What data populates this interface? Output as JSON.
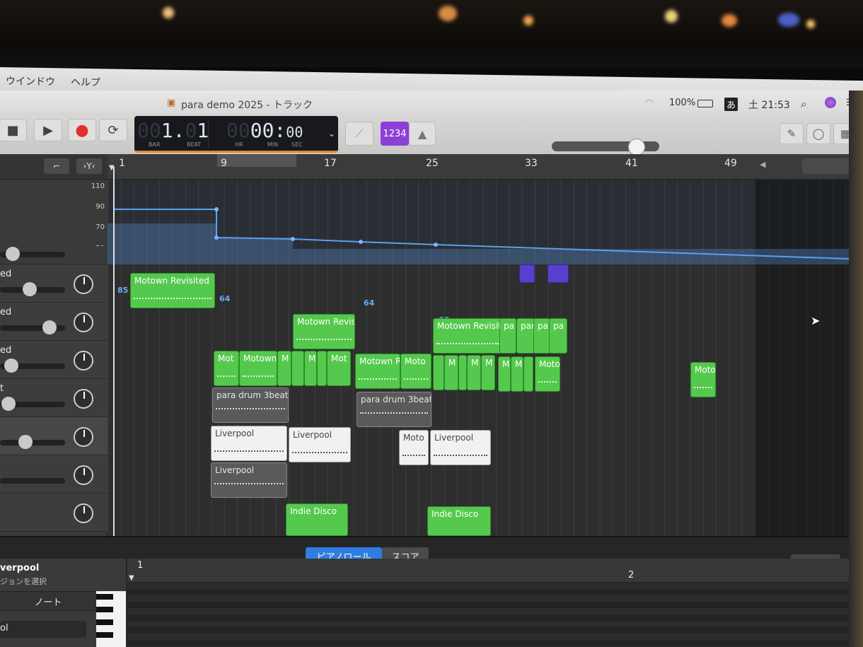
{
  "menubar": {
    "items": [
      "ウインドウ",
      "ヘルプ"
    ],
    "battery": "100%",
    "input_method": "あ",
    "clock": "土 21:53"
  },
  "window": {
    "title": "para demo 2025 - トラック"
  },
  "transport": {
    "stop_icon": "stop-icon",
    "play_icon": "play-icon",
    "record_icon": "record-icon",
    "cycle_icon": "cycle-icon"
  },
  "lcd": {
    "bar_dim": "00",
    "bar": "1.",
    "beat_dim": "0",
    "beat": "1",
    "bar_label": "BAR",
    "beat_label": "BEAT",
    "hr_dim": "00",
    "min_sec": "00:",
    "sec": "00",
    "hr_label": "HR",
    "min_label": "MIN",
    "sec_label": "SEC"
  },
  "controls": {
    "count_in": "1234",
    "metronome_icon": "metronome-icon",
    "tuner_icon": "tuner-icon"
  },
  "ruler": {
    "bars": [
      "1",
      "9",
      "17",
      "25",
      "33",
      "41",
      "49"
    ]
  },
  "automation": {
    "scale": [
      "110",
      "90",
      "70",
      "50"
    ],
    "points": [
      "85",
      "64",
      "66",
      "64",
      "66"
    ]
  },
  "tracks": [
    {
      "name": ""
    },
    {
      "name": "ed"
    },
    {
      "name": "ed"
    },
    {
      "name": "ed"
    },
    {
      "name": "t"
    },
    {
      "name": ""
    },
    {
      "name": ""
    },
    {
      "name": ""
    }
  ],
  "regions": {
    "motown_revisited": "Motown Revisited",
    "motown_revisi": "Motown Revisi",
    "motown_revisite": "Motown Revisite",
    "pa": "pa",
    "par": "par",
    "mot": "Mot",
    "motown": "Motown",
    "m": "M",
    "motown_r": "Motown R",
    "moto": "Moto",
    "para_drum": "para drum 3beat.",
    "liverpool": "Liverpool",
    "indie_disco": "Indie Disco"
  },
  "editor": {
    "tab_piano_roll": "ピアノロール",
    "tab_score": "スコア",
    "region_name": "verpool",
    "region_hint": "ジョンを選択",
    "note_label": "ノート",
    "bottom_label": "ol",
    "ruler": [
      "1",
      "2"
    ]
  }
}
